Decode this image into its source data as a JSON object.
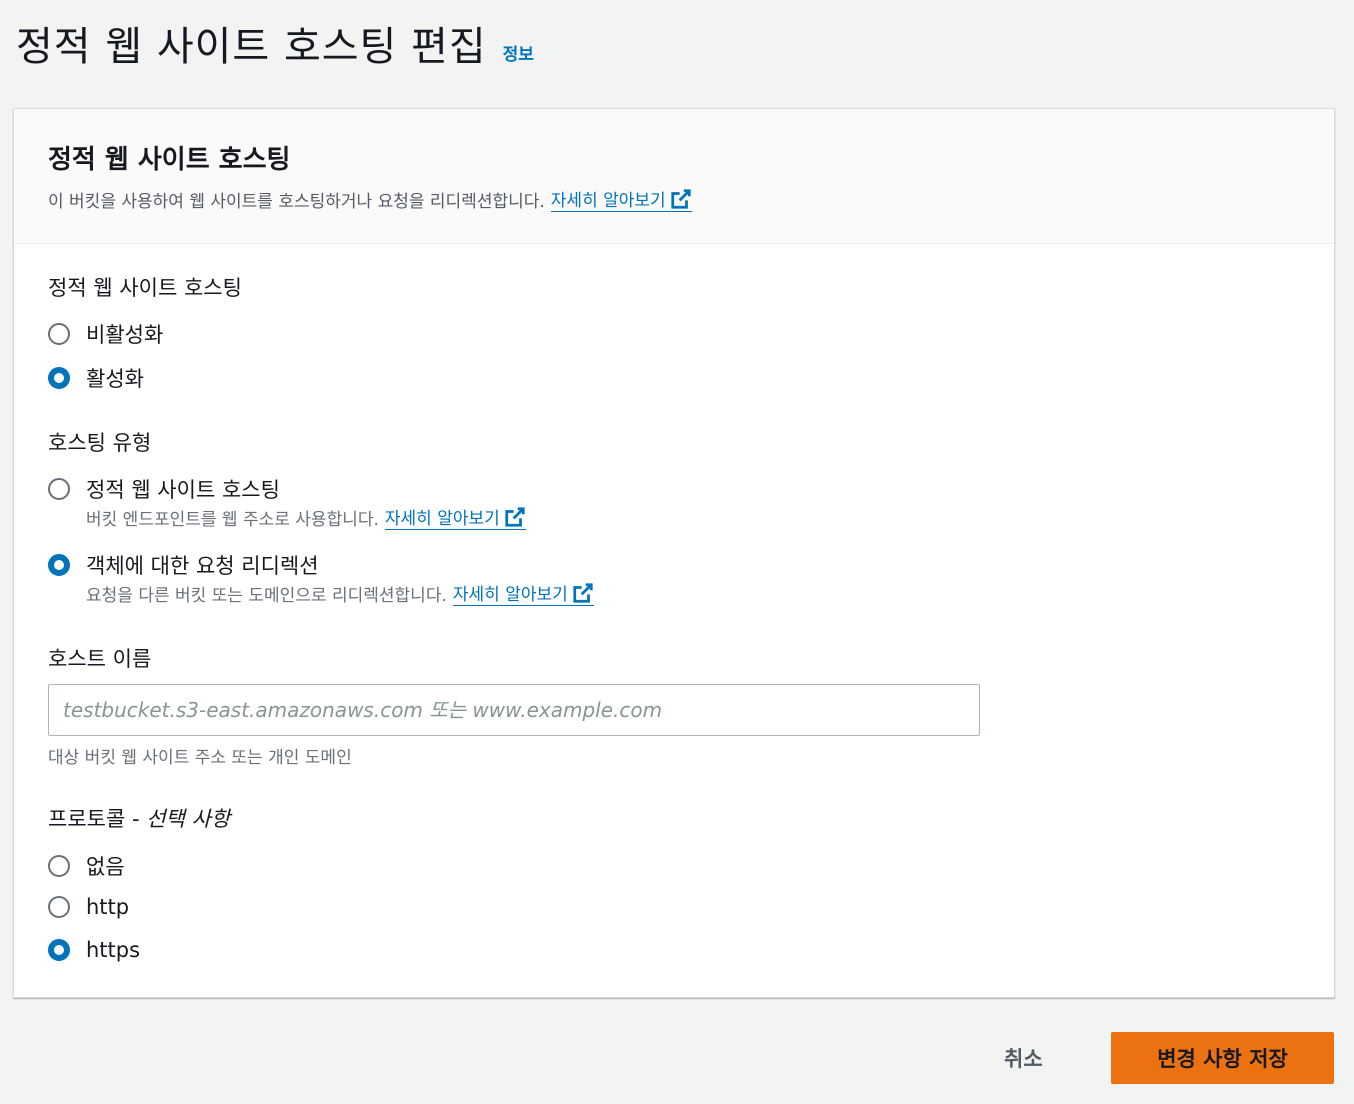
{
  "header": {
    "title": "정적 웹 사이트 호스팅 편집",
    "info_link": "정보"
  },
  "panel": {
    "title": "정적 웹 사이트 호스팅",
    "description": "이 버킷을 사용하여 웹 사이트를 호스팅하거나 요청을 리디렉션합니다.",
    "learn_more": "자세히 알아보기"
  },
  "hosting": {
    "label": "정적 웹 사이트 호스팅",
    "options": [
      {
        "label": "비활성화",
        "selected": false
      },
      {
        "label": "활성화",
        "selected": true
      }
    ]
  },
  "hosting_type": {
    "label": "호스팅 유형",
    "options": [
      {
        "label": "정적 웹 사이트 호스팅",
        "description": "버킷 엔드포인트를 웹 주소로 사용합니다.",
        "learn_more": "자세히 알아보기",
        "selected": false
      },
      {
        "label": "객체에 대한 요청 리디렉션",
        "description": "요청을 다른 버킷 또는 도메인으로 리디렉션합니다.",
        "learn_more": "자세히 알아보기",
        "selected": true
      }
    ]
  },
  "host_name": {
    "label": "호스트 이름",
    "placeholder": "testbucket.s3-east.amazonaws.com 또는 www.example.com",
    "value": "",
    "constraint": "대상 버킷 웹 사이트 주소 또는 개인 도메인"
  },
  "protocol": {
    "label": "프로토콜 - ",
    "optional": "선택 사항",
    "options": [
      {
        "label": "없음",
        "selected": false
      },
      {
        "label": "http",
        "selected": false
      },
      {
        "label": "https",
        "selected": true
      }
    ]
  },
  "actions": {
    "cancel": "취소",
    "save": "변경 사항 저장"
  },
  "colors": {
    "accent": "#0073bb",
    "primary_button": "#ec7211"
  }
}
